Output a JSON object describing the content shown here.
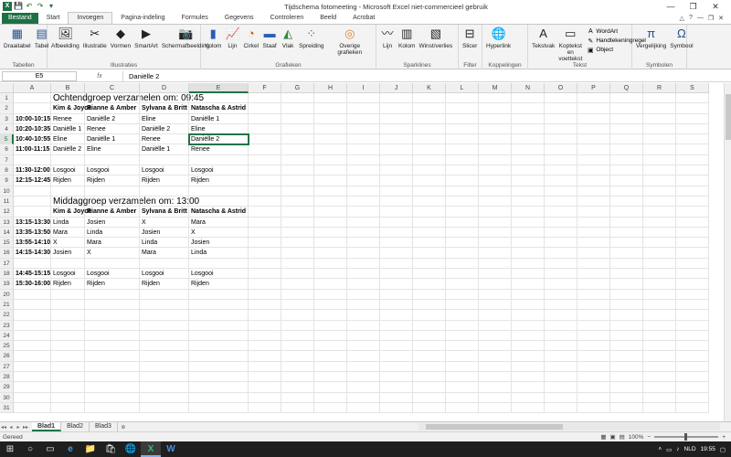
{
  "window": {
    "title": "Tijdschema fotomeeting  -  Microsoft Excel niet-commercieel gebruik",
    "minimize": "—",
    "maximize": "❐",
    "close": "✕"
  },
  "qat": {
    "save": "💾",
    "undo": "↶",
    "redo": "↷",
    "customize": "▾"
  },
  "tabs": {
    "file": "Bestand",
    "items": [
      "Start",
      "Invoegen",
      "Pagina-indeling",
      "Formules",
      "Gegevens",
      "Controleren",
      "Beeld",
      "Acrobat"
    ],
    "active_index": 1,
    "right_icons": [
      "△",
      "?",
      "—",
      "❐",
      "✕"
    ]
  },
  "ribbon": {
    "groups": [
      {
        "label": "Tabellen",
        "buttons": [
          {
            "label": "Draaitabel",
            "icon": "▦"
          },
          {
            "label": "Tabel",
            "icon": "▤"
          }
        ]
      },
      {
        "label": "Illustraties",
        "buttons": [
          {
            "label": "Afbeelding",
            "icon": "🖼"
          },
          {
            "label": "Illustratie",
            "icon": "✂"
          },
          {
            "label": "Vormen",
            "icon": "◆"
          },
          {
            "label": "SmartArt",
            "icon": "▶"
          },
          {
            "label": "Schermafbeelding",
            "icon": "📷"
          }
        ]
      },
      {
        "label": "Grafieken",
        "buttons": [
          {
            "label": "Kolom",
            "icon": "▮"
          },
          {
            "label": "Lijn",
            "icon": "📈"
          },
          {
            "label": "Cirkel",
            "icon": "◔"
          },
          {
            "label": "Staaf",
            "icon": "▬"
          },
          {
            "label": "Vlak",
            "icon": "◭"
          },
          {
            "label": "Spreiding",
            "icon": "⁘"
          },
          {
            "label": "Overige grafieken",
            "icon": "◎"
          }
        ]
      },
      {
        "label": "Sparklines",
        "buttons": [
          {
            "label": "Lijn",
            "icon": "〰"
          },
          {
            "label": "Kolom",
            "icon": "▥"
          },
          {
            "label": "Winst/verlies",
            "icon": "▧"
          }
        ]
      },
      {
        "label": "Filter",
        "buttons": [
          {
            "label": "Slicer",
            "icon": "⊟"
          }
        ]
      },
      {
        "label": "Koppelingen",
        "buttons": [
          {
            "label": "Hyperlink",
            "icon": "🌐"
          }
        ]
      },
      {
        "label": "Tekst",
        "buttons": [
          {
            "label": "Tekstvak",
            "icon": "A"
          },
          {
            "label": "Koptekst en voettekst",
            "icon": "▭"
          }
        ],
        "small": [
          {
            "label": "WordArt",
            "icon": "A"
          },
          {
            "label": "Handtekeningregel",
            "icon": "✎"
          },
          {
            "label": "Object",
            "icon": "▣"
          }
        ]
      },
      {
        "label": "Symbolen",
        "buttons": [
          {
            "label": "Vergelijking",
            "icon": "π"
          },
          {
            "label": "Symbool",
            "icon": "Ω"
          }
        ]
      }
    ]
  },
  "formula": {
    "namebox": "E5",
    "fx": "fx",
    "value": "Daniëlle 2"
  },
  "sheet": {
    "columns": [
      "A",
      "B",
      "C",
      "D",
      "E",
      "F",
      "G",
      "H",
      "I",
      "J",
      "K",
      "L",
      "M",
      "N",
      "O",
      "P",
      "Q",
      "R",
      "S"
    ],
    "selected_column": "E",
    "selected_row": 5,
    "rows": [
      {
        "n": 1,
        "cells": {
          "B": "Ochtendgroep verzamelen om: 09:45"
        },
        "big": true
      },
      {
        "n": 2,
        "cells": {
          "B": "Kim & Joyce",
          "C": "Rianne & Amber",
          "D": "Sylvana & Britt",
          "E": "Natascha & Astrid"
        },
        "bold": [
          "B",
          "C",
          "D",
          "E"
        ]
      },
      {
        "n": 3,
        "cells": {
          "A": "10:00-10:15",
          "B": "Renee",
          "C": "Daniëlle 2",
          "D": "Eline",
          "E": "Daniëlle 1"
        },
        "bold": [
          "A"
        ]
      },
      {
        "n": 4,
        "cells": {
          "A": "10:20-10:35",
          "B": "Daniëlle 1",
          "C": "Renee",
          "D": "Daniëlle 2",
          "E": "Eline"
        },
        "bold": [
          "A"
        ]
      },
      {
        "n": 5,
        "cells": {
          "A": "10:40-10:55",
          "B": "Eline",
          "C": "Daniëlle 1",
          "D": "Renee",
          "E": "Daniëlle 2"
        },
        "bold": [
          "A"
        ]
      },
      {
        "n": 6,
        "cells": {
          "A": "11:00-11:15",
          "B": "Daniëlle 2",
          "C": "Eline",
          "D": "Daniëlle 1",
          "E": "Renee"
        },
        "bold": [
          "A"
        ]
      },
      {
        "n": 7,
        "cells": {}
      },
      {
        "n": 8,
        "cells": {
          "A": "11:30-12:00",
          "B": "Losgooi",
          "C": "Losgooi",
          "D": "Losgooi",
          "E": "Losgooi"
        },
        "bold": [
          "A"
        ]
      },
      {
        "n": 9,
        "cells": {
          "A": "12:15-12:45",
          "B": "Rijden",
          "C": "Rijden",
          "D": "Rijden",
          "E": "Rijden"
        },
        "bold": [
          "A"
        ]
      },
      {
        "n": 10,
        "cells": {}
      },
      {
        "n": 11,
        "cells": {
          "B": "Middaggroep verzamelen om: 13:00"
        },
        "big": true
      },
      {
        "n": 12,
        "cells": {
          "B": "Kim & Joyce",
          "C": "Rianne & Amber",
          "D": "Sylvana & Britt",
          "E": "Natascha & Astrid"
        },
        "bold": [
          "B",
          "C",
          "D",
          "E"
        ]
      },
      {
        "n": 13,
        "cells": {
          "A": "13:15-13:30",
          "B": "Linda",
          "C": "Josien",
          "D": "X",
          "E": "Mara"
        },
        "bold": [
          "A"
        ]
      },
      {
        "n": 14,
        "cells": {
          "A": "13:35-13:50",
          "B": "Mara",
          "C": "Linda",
          "D": "Josien",
          "E": "X"
        },
        "bold": [
          "A"
        ]
      },
      {
        "n": 15,
        "cells": {
          "A": "13:55-14:10",
          "B": "X",
          "C": "Mara",
          "D": "Linda",
          "E": "Josien"
        },
        "bold": [
          "A"
        ]
      },
      {
        "n": 16,
        "cells": {
          "A": "14:15-14:30",
          "B": "Josien",
          "C": "X",
          "D": "Mara",
          "E": "Linda"
        },
        "bold": [
          "A"
        ]
      },
      {
        "n": 17,
        "cells": {}
      },
      {
        "n": 18,
        "cells": {
          "A": "14:45-15:15",
          "B": "Losgooi",
          "C": "Losgooi",
          "D": "Losgooi",
          "E": "Losgooi"
        },
        "bold": [
          "A"
        ]
      },
      {
        "n": 19,
        "cells": {
          "A": "15:30-16:00",
          "B": "Rijden",
          "C": "Rijden",
          "D": "Rijden",
          "E": "Rijden"
        },
        "bold": [
          "A"
        ]
      },
      {
        "n": 20,
        "cells": {}
      },
      {
        "n": 21,
        "cells": {}
      },
      {
        "n": 22,
        "cells": {}
      },
      {
        "n": 23,
        "cells": {}
      },
      {
        "n": 24,
        "cells": {}
      },
      {
        "n": 25,
        "cells": {}
      },
      {
        "n": 26,
        "cells": {}
      },
      {
        "n": 27,
        "cells": {}
      },
      {
        "n": 28,
        "cells": {}
      },
      {
        "n": 29,
        "cells": {}
      },
      {
        "n": 30,
        "cells": {}
      },
      {
        "n": 31,
        "cells": {}
      }
    ]
  },
  "sheet_tabs": {
    "items": [
      "Blad1",
      "Blad2",
      "Blad3"
    ],
    "active_index": 0,
    "nav": [
      "◂◂",
      "◂",
      "▸",
      "▸▸"
    ],
    "new_sheet": "⊕"
  },
  "status": {
    "text": "Gereed",
    "zoom": "100%",
    "zoom_minus": "−",
    "zoom_plus": "+"
  },
  "taskbar": {
    "icons": [
      "⊞",
      "○",
      "▭",
      "e",
      "📁",
      "🛍",
      "🌐",
      "X",
      "W"
    ],
    "active_index": 7,
    "lang": "NLD",
    "time": "19:55"
  }
}
